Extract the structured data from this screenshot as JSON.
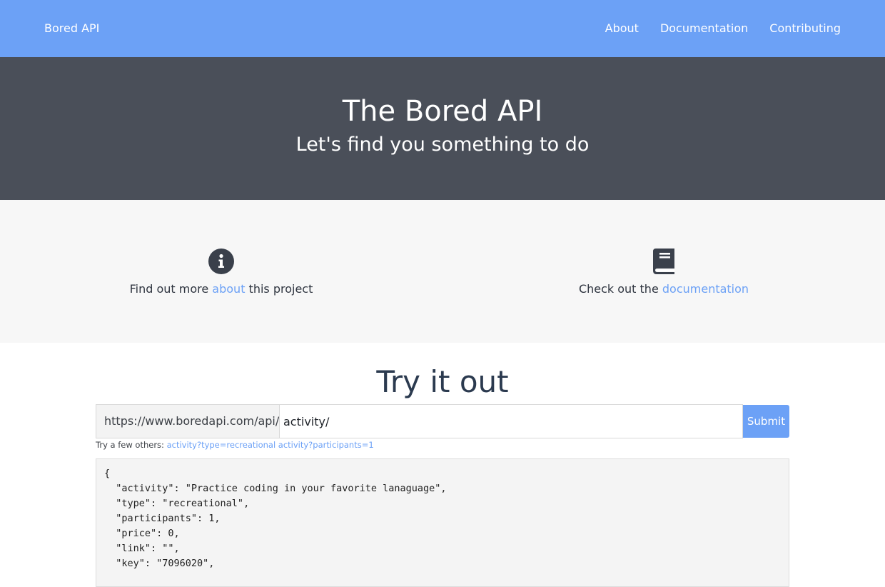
{
  "navbar": {
    "brand": "Bored API",
    "links": [
      {
        "label": "About"
      },
      {
        "label": "Documentation"
      },
      {
        "label": "Contributing"
      }
    ]
  },
  "hero": {
    "title": "The Bored API",
    "subtitle": "Let's find you something to do"
  },
  "features": {
    "about": {
      "icon": "info-circle-icon",
      "text_before": "Find out more ",
      "link": "about",
      "text_after": " this project"
    },
    "docs": {
      "icon": "book-icon",
      "text_before": "Check out the ",
      "link": "documentation"
    }
  },
  "try_it": {
    "title": "Try it out",
    "base_url": "https://www.boredapi.com/api/",
    "input_value": "activity/",
    "submit_label": "Submit",
    "others_label": "Try a few others:",
    "examples": [
      "activity?type=recreational",
      "activity?participants=1"
    ]
  },
  "response": {
    "lines": [
      "{",
      "  \"activity\": \"Practice coding in your favorite lanaguage\",",
      "  \"type\": \"recreational\",",
      "  \"participants\": 1,",
      "  \"price\": 0,",
      "  \"link\": \"\",",
      "  \"key\": \"7096020\","
    ]
  },
  "colors": {
    "navbar": "#6ca1f6",
    "hero": "#4a4f59",
    "link": "#6ca1f6",
    "icon": "#3a404b"
  }
}
